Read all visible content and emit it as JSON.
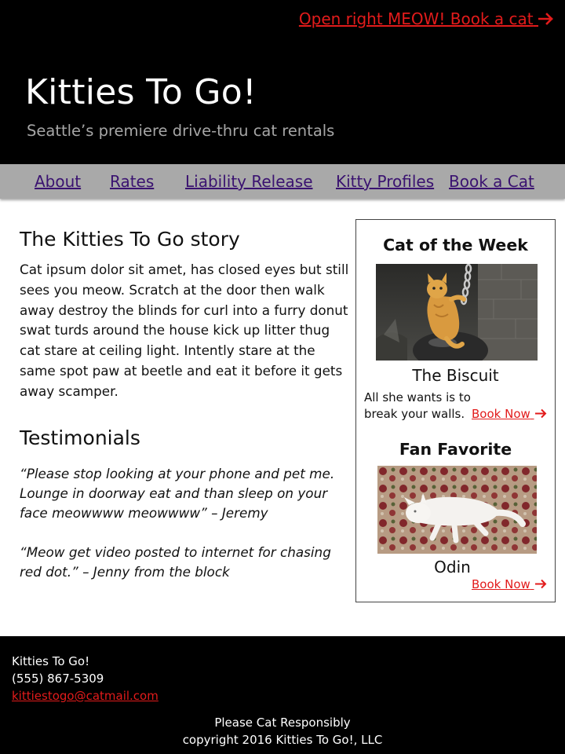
{
  "colors": {
    "header_bg": "#000000",
    "nav_bg": "#a9a9a9",
    "nav_link": "#3a1270",
    "accent_red": "#e21b1b",
    "tagline": "#a6a6a6"
  },
  "header": {
    "cta_label": "Open right MEOW! Book a cat",
    "cta_icon": "arrow-right-icon",
    "title": "Kitties To Go!",
    "tagline": "Seattle’s premiere drive-thru cat rentals"
  },
  "nav": {
    "items": [
      {
        "label": "About"
      },
      {
        "label": "Rates"
      },
      {
        "label": "Liability Release"
      },
      {
        "label": "Kitty Profiles"
      },
      {
        "label": "Book a Cat"
      }
    ]
  },
  "main": {
    "story_heading": "The Kitties To Go story",
    "story_text": "Cat ipsum dolor sit amet, has closed eyes but still sees you meow. Scratch at the door then walk away destroy the blinds for curl into a furry donut swat turds around the house kick up litter thug cat stare at ceiling light. Intently stare at the same spot paw at beetle and eat it before it gets away scamper.",
    "testimonials_heading": "Testimonials",
    "testimonials": [
      {
        "text": "“Please stop looking at your phone and pet me. Lounge in doorway eat and than sleep on your face meowwww meowwww” – Jeremy"
      },
      {
        "text": "“Meow get video posted to internet for chasing red dot.” – Jenny from the block"
      }
    ]
  },
  "sidebar": {
    "cat_of_week_heading": "Cat of the Week",
    "cat_of_week_name": "The Biscuit",
    "cat_of_week_desc_line1": "All she wants is to",
    "cat_of_week_desc_line2": "break your walls.",
    "book_now_label": "Book Now",
    "fan_favorite_heading": "Fan Favorite",
    "fan_favorite_name": "Odin"
  },
  "footer": {
    "company": "Kitties To Go!",
    "phone": "(555) 867-5309",
    "email": "kittiestogo@catmail.com",
    "motto": "Please Cat Responsibly",
    "copyright": "copyright 2016 Kitties To Go!, LLC"
  }
}
